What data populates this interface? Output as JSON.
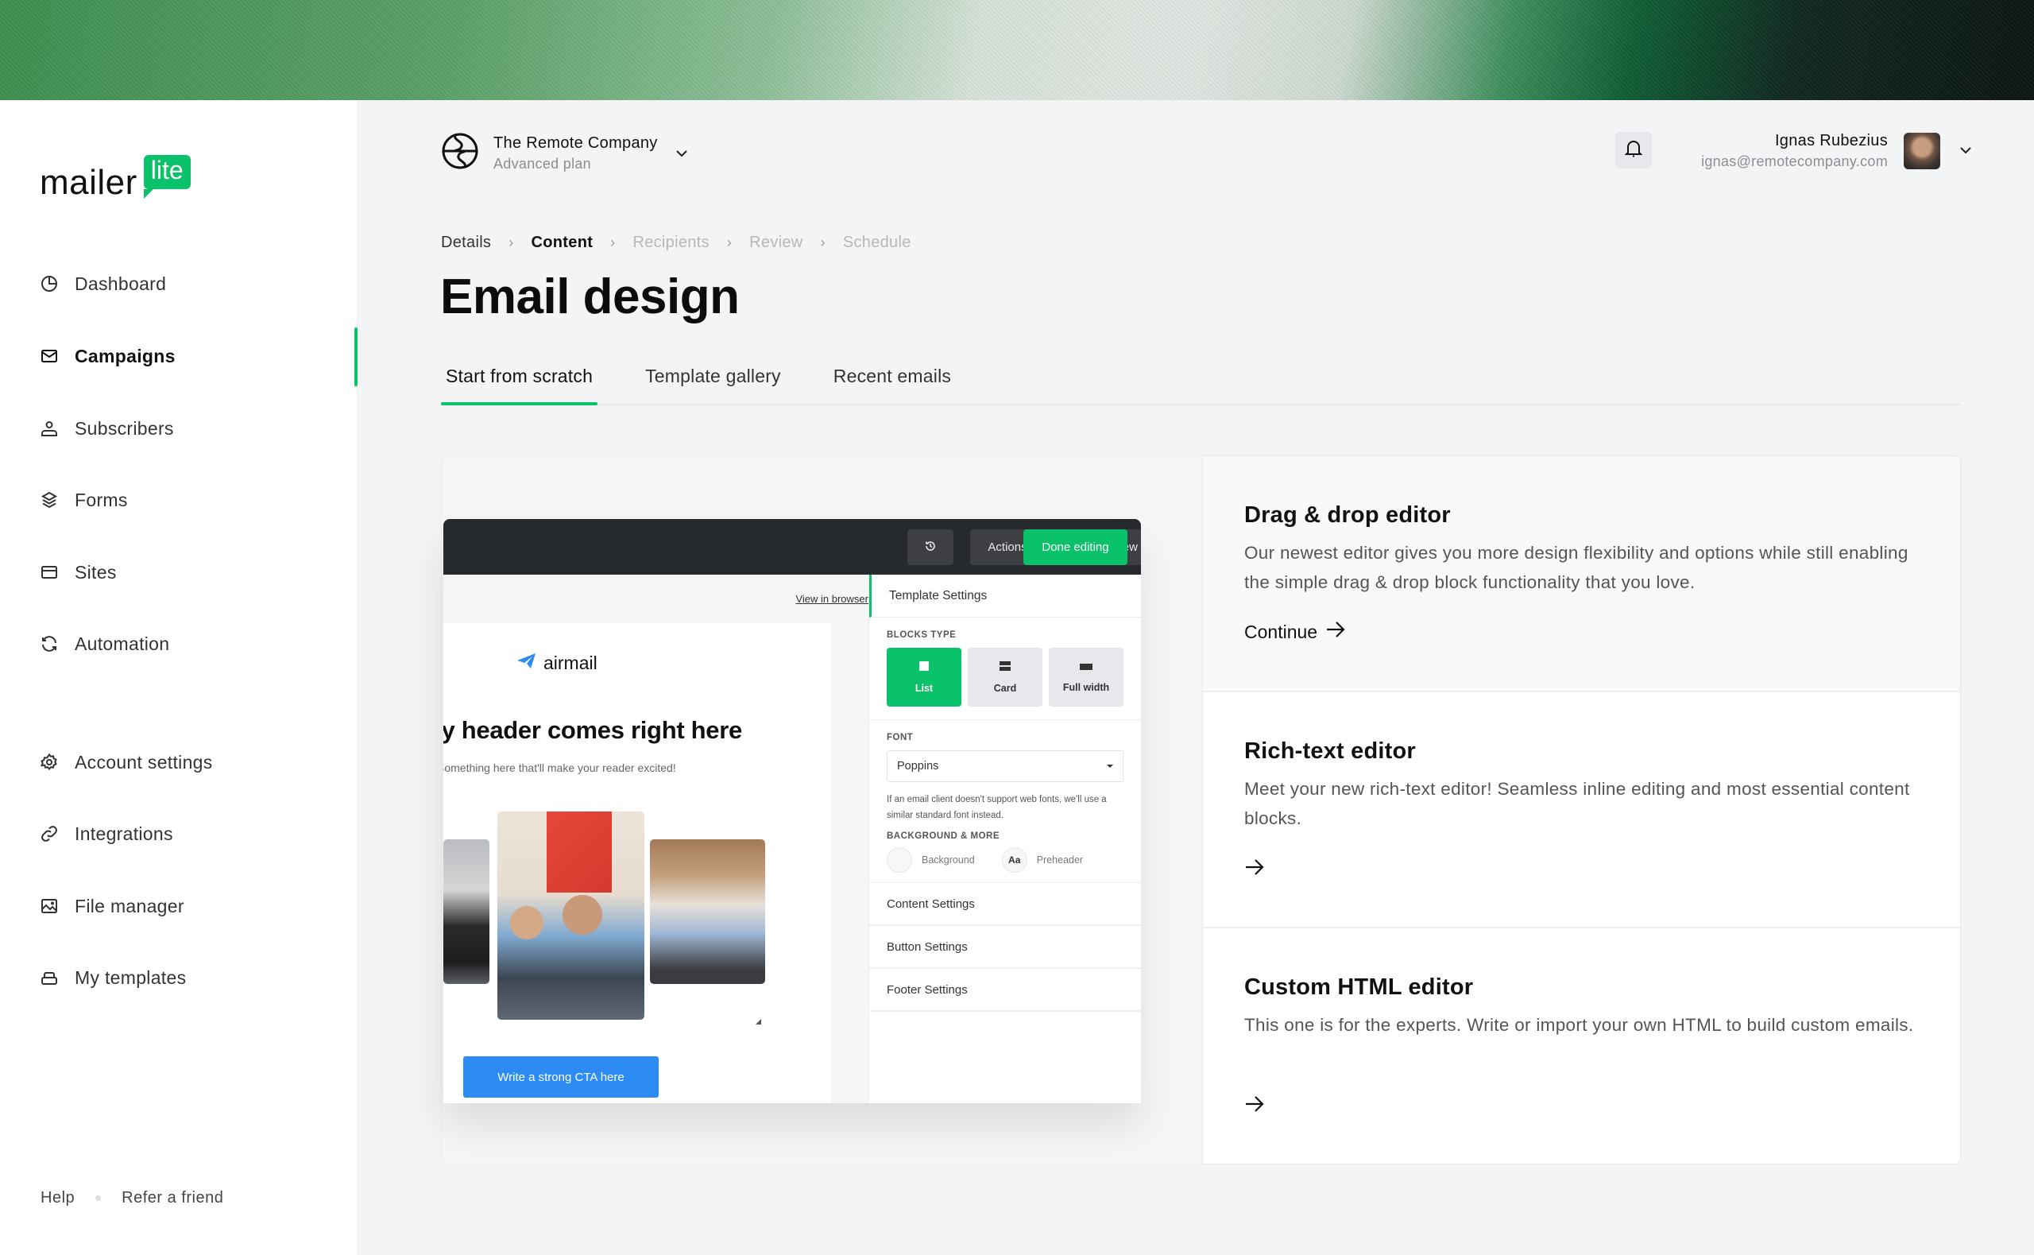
{
  "brand": {
    "logo_text": "mailer",
    "logo_badge": "lite",
    "accent_color": "#09c269"
  },
  "sidebar": {
    "primary_items": [
      {
        "label": "Dashboard",
        "icon": "pie-chart-icon",
        "active": false
      },
      {
        "label": "Campaigns",
        "icon": "mail-icon",
        "active": true
      },
      {
        "label": "Subscribers",
        "icon": "user-icon",
        "active": false
      },
      {
        "label": "Forms",
        "icon": "layers-icon",
        "active": false
      },
      {
        "label": "Sites",
        "icon": "browser-window-icon",
        "active": false
      },
      {
        "label": "Automation",
        "icon": "refresh-icon",
        "active": false
      }
    ],
    "secondary_items": [
      {
        "label": "Account settings",
        "icon": "gear-icon"
      },
      {
        "label": "Integrations",
        "icon": "link-icon"
      },
      {
        "label": "File manager",
        "icon": "image-icon"
      },
      {
        "label": "My templates",
        "icon": "stack-icon"
      }
    ],
    "footer": {
      "help": "Help",
      "refer": "Refer a friend"
    }
  },
  "header": {
    "company_name": "The Remote Company",
    "plan": "Advanced plan",
    "user_name": "Ignas Rubezius",
    "user_email": "ignas@remotecompany.com"
  },
  "breadcrumb": [
    {
      "label": "Details",
      "state": "done"
    },
    {
      "label": "Content",
      "state": "current"
    },
    {
      "label": "Recipients",
      "state": "todo"
    },
    {
      "label": "Review",
      "state": "todo"
    },
    {
      "label": "Schedule",
      "state": "todo"
    }
  ],
  "page_title": "Email design",
  "tabs": [
    {
      "label": "Start from scratch",
      "active": true
    },
    {
      "label": "Template gallery",
      "active": false
    },
    {
      "label": "Recent emails",
      "active": false
    }
  ],
  "preview": {
    "toolbar": {
      "actions": "Actions",
      "preview_test": "Preview and test",
      "done": "Done editing"
    },
    "view_in_browser": "View in browser",
    "email": {
      "brand": "airmail",
      "heading": "My header comes right here",
      "subheading": "Something here that'll make your reader excited!",
      "cta": "Write a strong CTA here"
    },
    "settings": {
      "title": "Template Settings",
      "blocks_type_label": "BLOCKS TYPE",
      "blocks": [
        {
          "label": "List",
          "active": true
        },
        {
          "label": "Card",
          "active": false
        },
        {
          "label": "Full width",
          "active": false
        }
      ],
      "font_label": "FONT",
      "font_value": "Poppins",
      "font_note": "If an email client doesn't support web fonts, we'll use a similar standard font instead.",
      "background_label": "BACKGROUND & MORE",
      "background": "Background",
      "preheader_badge": "Aa",
      "preheader": "Preheader",
      "items": [
        "Content Settings",
        "Button Settings",
        "Footer Settings"
      ]
    }
  },
  "editors": [
    {
      "title": "Drag & drop editor",
      "description": "Our newest editor gives you more design flexibility and options while still enabling the simple drag & drop block functionality that you love.",
      "link_label": "Continue",
      "highlighted": true
    },
    {
      "title": "Rich-text editor",
      "description": "Meet your new rich-text editor! Seamless inline editing and most essential content blocks.",
      "link_label": "",
      "highlighted": false
    },
    {
      "title": "Custom HTML editor",
      "description": "This one is for the experts. Write or import your own HTML to build custom emails.",
      "link_label": "",
      "highlighted": false
    }
  ]
}
